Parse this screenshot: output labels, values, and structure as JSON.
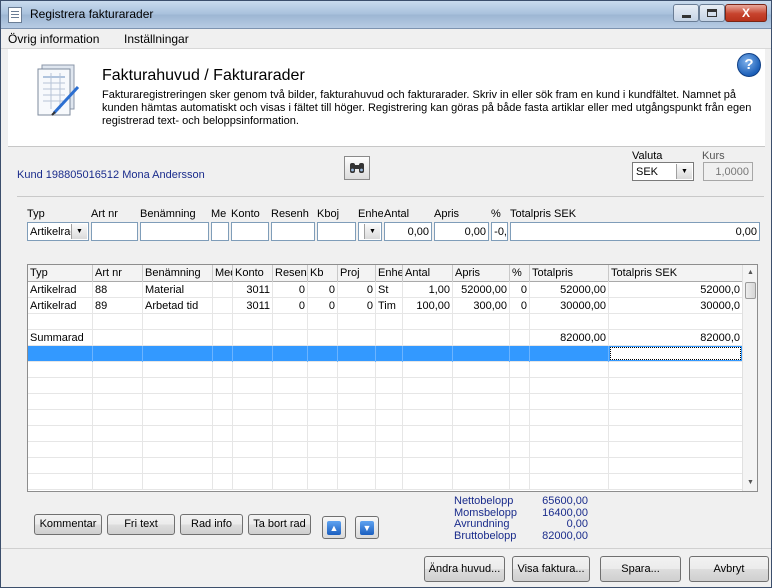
{
  "window": {
    "title": "Registrera fakturarader",
    "close_label": "X"
  },
  "menu": {
    "items": [
      "Övrig information",
      "Inställningar"
    ]
  },
  "header": {
    "title": "Fakturahuvud / Fakturarader",
    "description": "Fakturaregistreringen sker genom två bilder, fakturahuvud och fakturarader. Skriv in eller sök fram en kund i kundfältet. Namnet på kunden hämtas automatiskt och visas i fältet till höger. Registrering kan göras på både fasta artiklar eller med utgångspunkt från egen registrerad text- och beloppsinformation.",
    "help_label": "?"
  },
  "customer": {
    "label": "Kund 198805016512 Mona Andersson"
  },
  "currency": {
    "valuta_label": "Valuta",
    "valuta_value": "SEK",
    "kurs_label": "Kurs",
    "kurs_value": "1,0000"
  },
  "entry": {
    "labels": [
      "Typ",
      "Art nr",
      "Benämning",
      "Me",
      "Konto",
      "Resenh",
      "Kboj",
      "Enhe",
      "Antal",
      "Apris",
      "%",
      "Totalpris SEK"
    ],
    "values": {
      "typ": "Artikelrad",
      "art_nr": "",
      "benamning": "",
      "me": "",
      "konto": "",
      "resenh": "",
      "kboj": "",
      "enhet": "",
      "antal": "0,00",
      "apris": "0,00",
      "procent": "-0,",
      "totalpris": "0,00"
    }
  },
  "grid": {
    "headers": [
      "Typ",
      "Art nr",
      "Benämning",
      "Med",
      "Konto",
      "Resen",
      "Kb",
      "Proj",
      "Enhe",
      "Antal",
      "Apris",
      "%",
      "Totalpris",
      "Totalpris SEK"
    ],
    "rows": [
      [
        "Artikelrad",
        "88",
        "Material",
        "",
        "3011",
        "0",
        "0",
        "0",
        "St",
        "1,00",
        "52000,00",
        "0",
        "52000,00",
        "52000,0"
      ],
      [
        "Artikelrad",
        "89",
        "Arbetad tid",
        "",
        "3011",
        "0",
        "0",
        "0",
        "Tim",
        "100,00",
        "300,00",
        "0",
        "30000,00",
        "30000,0"
      ],
      [
        "",
        "",
        "",
        "",
        "",
        "",
        "",
        "",
        "",
        "",
        "",
        "",
        "",
        ""
      ],
      [
        "Summarad",
        "",
        "",
        "",
        "",
        "",
        "",
        "",
        "",
        "",
        "",
        "",
        "82000,00",
        "82000,0"
      ]
    ]
  },
  "buttons": {
    "kommentar": "Kommentar",
    "fri_text": "Fri text",
    "rad_info": "Rad info",
    "ta_bort_rad": "Ta bort rad",
    "andra_huvud": "Ändra huvud...",
    "visa_faktura": "Visa faktura...",
    "spara": "Spara...",
    "avbryt": "Avbryt"
  },
  "totals": {
    "nettobelopp_label": "Nettobelopp",
    "nettobelopp": "65600,00",
    "momsbelopp_label": "Momsbelopp",
    "momsbelopp": "16400,00",
    "avrundning_label": "Avrundning",
    "avrundning": "0,00",
    "bruttobelopp_label": "Bruttobelopp",
    "bruttobelopp": "82000,00"
  },
  "colors": {
    "accent_blue": "#1a2c8c",
    "selection": "#3399ff"
  }
}
